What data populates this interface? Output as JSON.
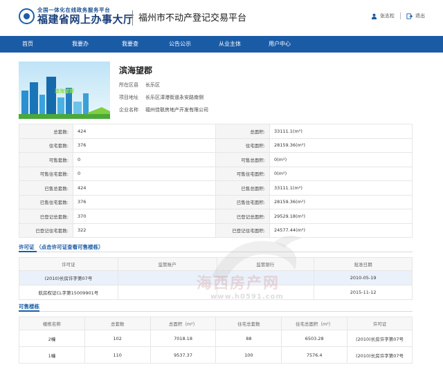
{
  "header": {
    "logo_small": "全国一体化在线政务服务平台",
    "logo_big": "福建省网上办事大厅",
    "platform_title": "福州市不动产登记交易平台",
    "username": "张志松",
    "logout": "退出"
  },
  "nav": [
    "首页",
    "我要办",
    "我要查",
    "公告公示",
    "从业主体",
    "用户中心"
  ],
  "project": {
    "image_caption": "滨海望郡",
    "name": "滨海望郡",
    "district_label": "所在区县",
    "district": "长乐区",
    "address_label": "项目地址",
    "address": "长乐区漳港街道永安路南侧",
    "company_label": "企业名称",
    "company": "福州佳联房地产开发有限公司"
  },
  "stats": [
    [
      "总套数:",
      "424",
      "总面积:",
      "33111.1(m²)"
    ],
    [
      "住宅套数:",
      "376",
      "住宅面积:",
      "28159.36(m²)"
    ],
    [
      "可售套数:",
      "0",
      "可售总面积:",
      "0(m²)"
    ],
    [
      "可售住宅套数:",
      "0",
      "可售住宅面积:",
      "0(m²)"
    ],
    [
      "已售总套数:",
      "424",
      "已售总面积:",
      "33111.1(m²)"
    ],
    [
      "已售住宅套数:",
      "376",
      "已售住宅面积:",
      "28159.36(m²)"
    ],
    [
      "已登记总套数:",
      "370",
      "已登记总面积:",
      "29529.18(m²)"
    ],
    [
      "已登记住宅套数:",
      "322",
      "已登记住宅面积:",
      "24577.44(m²)"
    ]
  ],
  "permit": {
    "title": "许可证 （点击许可证查看可售楼栋）",
    "headers": [
      "许可证",
      "监管账户",
      "监管银行",
      "批准日期"
    ],
    "rows": [
      [
        "(2010)长房许字第07号",
        "",
        "",
        "2010-05-19"
      ],
      [
        "航房权证CL字第15009901号",
        "",
        "",
        "2015-11-12"
      ]
    ]
  },
  "buildings": {
    "title": "可售楼栋",
    "headers": [
      "楼栋名称",
      "总套数",
      "总面积（m²）",
      "住宅总套数",
      "住宅总面积（m²）",
      "许可证"
    ],
    "rows": [
      [
        "2幢",
        "102",
        "7018.18",
        "88",
        "6503.28",
        "(2010)长房许字第07号"
      ],
      [
        "1幢",
        "110",
        "9537.37",
        "100",
        "7576.4",
        "(2010)长房许字第07号"
      ]
    ]
  },
  "watermark": {
    "text": "海西房产网",
    "url": "www.h0591.com"
  }
}
